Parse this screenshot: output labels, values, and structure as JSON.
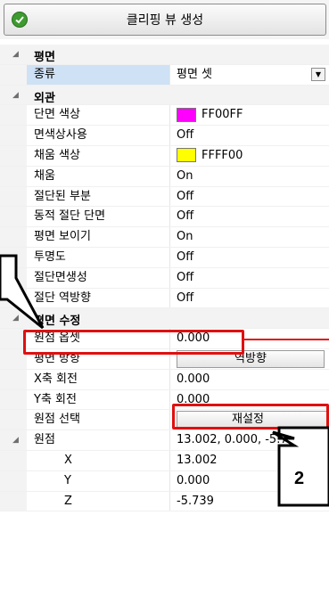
{
  "toolbar": {
    "create_label": "클리핑 뷰 생성",
    "check_icon": "check-circle-icon"
  },
  "categories": {
    "plane": "평면",
    "appearance": "외관",
    "plane_edit": "평면 수정"
  },
  "plane": {
    "kind_label": "종류",
    "kind_value": "평면 셋"
  },
  "appearance": {
    "section_color_label": "단면 색상",
    "section_color_value": "FF00FF",
    "section_color_hex": "#ff00ff",
    "use_section_color_label": "면색상사용",
    "use_section_color_value": "Off",
    "fill_color_label": "채움 색상",
    "fill_color_value": "FFFF00",
    "fill_color_hex": "#ffff00",
    "fill_label": "채움",
    "fill_value": "On",
    "cut_part_label": "절단된 부분",
    "cut_part_value": "Off",
    "dynamic_section_label": "동적 절단 단면",
    "dynamic_section_value": "Off",
    "show_plane_label": "평면 보이기",
    "show_plane_value": "On",
    "transparency_label": "투명도",
    "transparency_value": "Off",
    "create_section_label": "절단면생성",
    "create_section_value": "Off",
    "reverse_cut_label": "절단 역방향",
    "reverse_cut_value": "Off"
  },
  "plane_edit": {
    "origin_offset_label": "원점 옵셋",
    "origin_offset_value": "0.000",
    "plane_direction_label": "평면 방향",
    "plane_direction_button": "역방향",
    "x_rotation_label": "X축 회전",
    "x_rotation_value": "0.000",
    "y_rotation_label": "Y축 회전",
    "y_rotation_value": "0.000",
    "origin_select_label": "원점 선택",
    "origin_select_button": "재설정",
    "origin_label": "원점",
    "origin_value": "13.002, 0.000, -5.739",
    "x_label": "X",
    "x_value": "13.002",
    "y_label": "Y",
    "y_value": "0.000",
    "z_label": "Z",
    "z_value": "-5.739"
  },
  "annotation": {
    "callout_number": "2",
    "highlight_color": "#e01010"
  }
}
